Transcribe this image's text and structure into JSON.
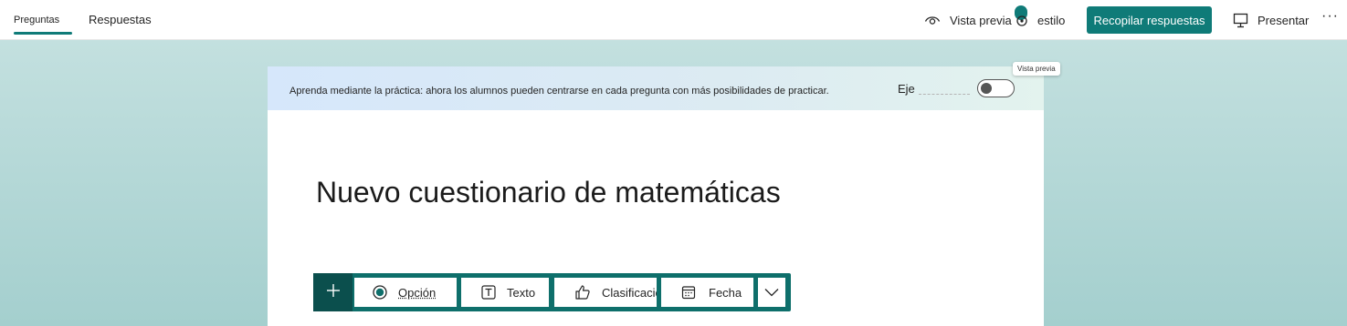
{
  "tabs": [
    {
      "label": "Preguntas",
      "active": true
    },
    {
      "label": "Respuestas",
      "active": false
    }
  ],
  "toolbar": {
    "preview_label": "Vista previa",
    "preview_icon": "eye-icon",
    "style_label": "estilo",
    "style_icon": "palette-icon",
    "collect_label": "Recopilar respuestas",
    "present_label": "Presentar",
    "present_icon": "monitor-icon",
    "more_label": "···"
  },
  "banner": {
    "text": "Aprenda mediante la práctica: ahora los alumnos pueden centrarse en cada pregunta con más posibilidades de practicar.",
    "axis_label": "Eje",
    "toggle_on": false,
    "tooltip": "Vista previa"
  },
  "form": {
    "title": "Nuevo cuestionario de matemáticas"
  },
  "question_types": [
    {
      "label": "Opción",
      "icon": "radio-icon"
    },
    {
      "label": "Texto",
      "icon": "text-icon"
    },
    {
      "label": "Clasificación",
      "icon": "thumbs-up-icon"
    },
    {
      "label": "Fecha",
      "icon": "calendar-icon"
    }
  ],
  "colors": {
    "accent": "#0f7b78",
    "accent_dark": "#0b4f4d",
    "background": "#b9dbda"
  }
}
